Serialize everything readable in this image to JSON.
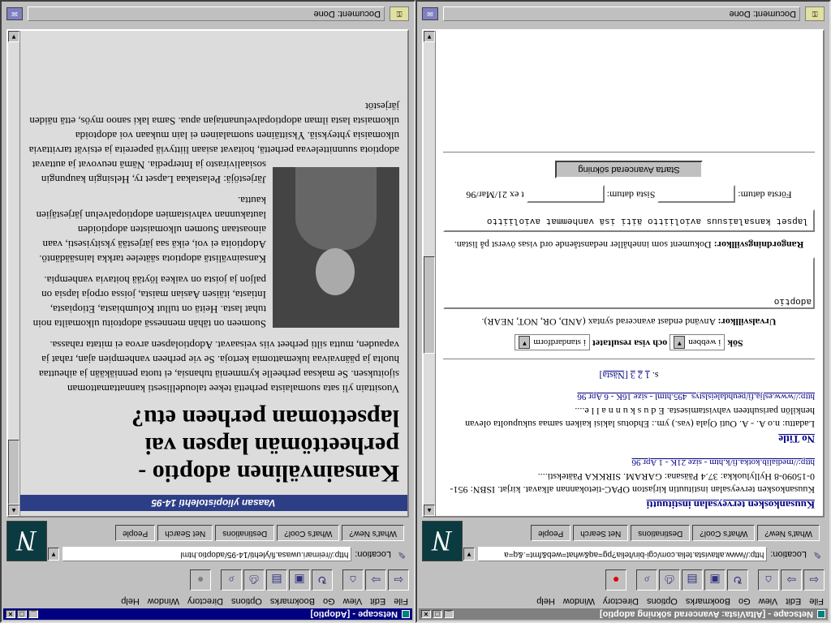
{
  "left_window": {
    "title": "Netscape - [Adoptio]",
    "menu": [
      "File",
      "Edit",
      "View",
      "Go",
      "Bookmarks",
      "Options",
      "Directory",
      "Window",
      "Help"
    ],
    "location_label": "Location:",
    "location_url": "http://reimari.uwasa.fi/ylehti/14-95/adoptio.html",
    "dir_buttons": [
      "What's New?",
      "What's Cool?",
      "Destinations",
      "Net Search",
      "People"
    ],
    "status_text": "Document: Done",
    "page": {
      "banner": "Vaasan yliopistolehti 14-95",
      "heading": "Kansainvälinen adoptio - perheettömän lapsen vai lapsettoman perheen etu?",
      "intro": "Vuosittain yli sata suomalaista perhettä tekee taloudellisesti kannattamattoman sijoituksen. Se maksaa perheelle kymmeniä tuhansia, ei tuota penniäkään ja aiheuttaa huolta ja päänvaivaa lukemattomia kertoja. Se vie perheen vanhempien ajan, rahat ja vapauden, mutta silti perheet viis veisaavat. Adoptiolapsen arvoa ei mitata rahassa.",
      "p2": "Suomeen on tähän mennessä adoptoitu ulkomailta noin tuhat lasta. Heitä on tullut Kolumbiasta, Etiopiasta, Intiasta, itäisen Aasian maista, joissa orpoja lapsia on paljon ja joista on vaikea löytää hoitavia vanhempia.",
      "p3": "Kansainvälistä adoptiota säätelee tarkka lainsäädäntö. Adoptioita ei voi, eikä saa järjestää yksityisesti, vaan ainoastaan Suomen ulkomaisten adoptioiden lautakunnan vahvistamien adoptiopalvelun järjestäjien kautta.",
      "p4": "Järjestöjä: Pelastakaa Lapset ry, Helsingin kaupungin sosiaalivirasto ja Interpedia. Nämä neuvovat ja auttavat adoptiota suunnittelevaa perhettä, hoitavat asiaan liittyviä papereita ja etsivät tarvittavia ulkomaisia yhteyksiä. Yksittäinen suomalainen ei lain mukaan voi adoptoida ulkomaista lasta ilman adoptiopalvelunantajan apua. Sama laki sanoo myös, että näiden järjestöt"
    }
  },
  "right_window": {
    "title": "Netscape - [AltaVista: Avancerad sökning adoptio]",
    "menu": [
      "File",
      "Edit",
      "View",
      "Go",
      "Bookmarks",
      "Options",
      "Directory",
      "Window",
      "Help"
    ],
    "location_label": "Location:",
    "location_url": "http://www.altavista.telia.com/cgi-bin/telia?pg=aq&what=web&fmt=.&q=a",
    "dir_buttons": [
      "What's New?",
      "What's Cool?",
      "Destinations",
      "Net Search",
      "People"
    ],
    "status_text": "Document: Done",
    "results": [
      {
        "title": "Kuusankosken terveysalan instituutti",
        "desc": "Kuusankosken terveysalan instituutin kirjaston OPAC-tietokannan alkavat. kirjat. ISBN: 951-0-15090-8 Hyllyluokka: 37.4 Pääsana: GARAM. SIRKKA Pääteksti....",
        "url": "http://medialib.kotka.fi/k.htm - size 21K - 1 Apr 96"
      },
      {
        "title": "No Title",
        "desc": "Ladattu: n.o A. - A. Outi Ojala (vas.) ym.: Ehdotus lakisi kaiken samaa sukupuolta olevan henkilön parisuhteen vahvistamisesta. E d u s k u n n a l l e....",
        "url": "http://www.eslja.fi/peuhdaleislstys_495.html - size 16K - 6 Apr 96"
      }
    ],
    "pager": {
      "prefix": "s.",
      "pages": [
        "1",
        "2",
        "3"
      ],
      "next": "[Nästa]"
    },
    "search_label": "Sök",
    "search_select": "i webben",
    "show_label": "och visa resultatet",
    "format_select": "i standardform",
    "selection_label": "Urvalsvillkor:",
    "selection_hint": "Använd endast avancerad syntax (AND, OR, NOT, NEAR).",
    "query_value": "adoptio",
    "ranking_label": "Rangordningsvillkor:",
    "ranking_hint": "Dokument som innehåller nedanstående ord visas överst på listan.",
    "ranking_value": "lapset kansalaisuus avioliitto äiti isä vanhemmat avioliitto",
    "first_date_label": "Första datum:",
    "last_date_label": "Sista datum:",
    "date_example": "t ex 21/Mar/96",
    "submit_label": "Starta Avancerad sökning"
  },
  "colors": {
    "title_active": "#000080",
    "title_inactive": "#808080",
    "chrome": "#c0c0c0",
    "link": "#000080"
  }
}
